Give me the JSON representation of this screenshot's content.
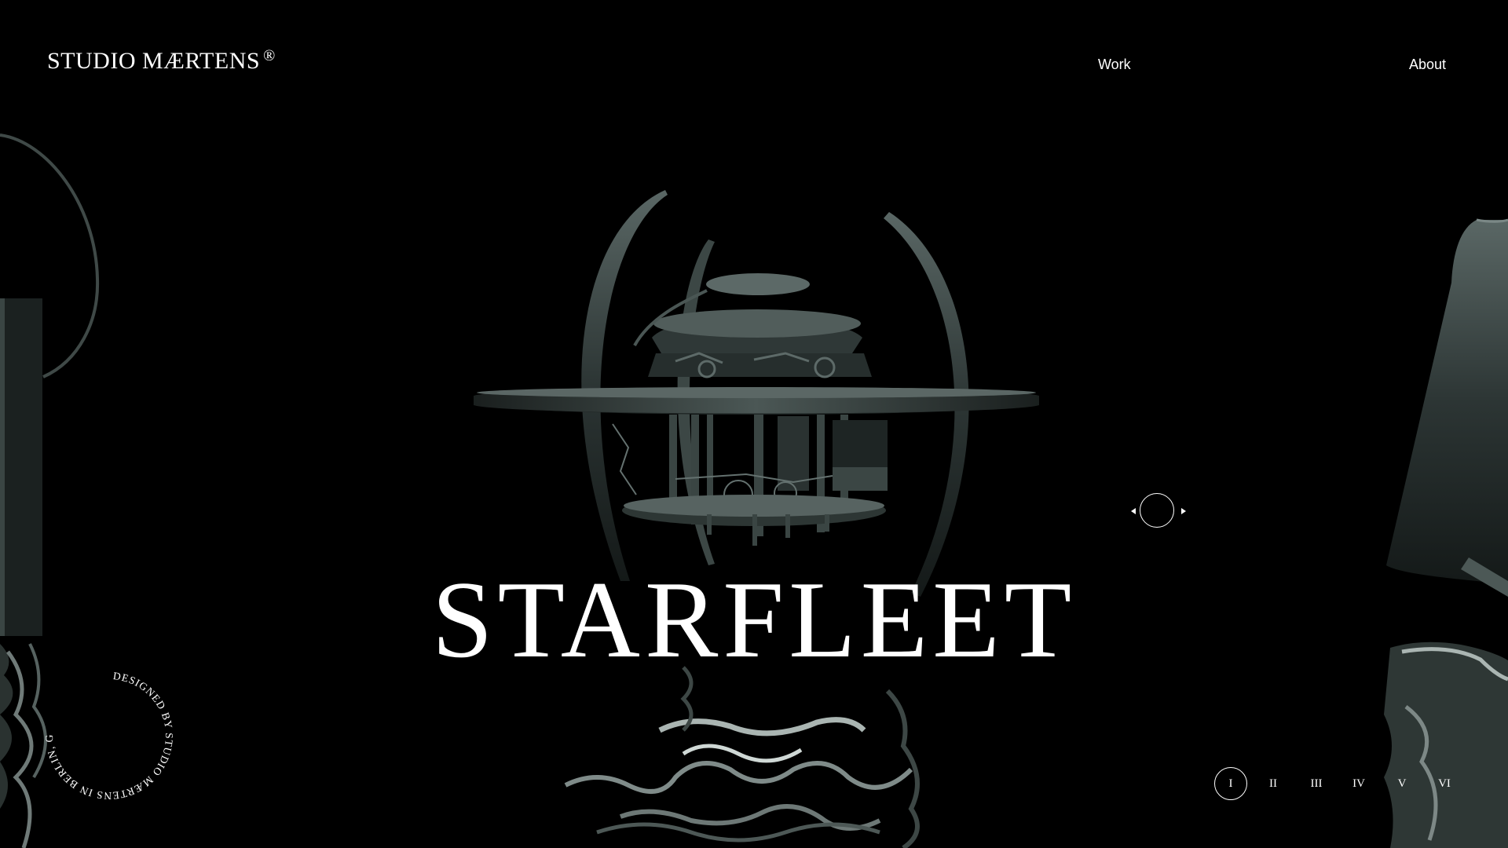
{
  "header": {
    "logo_text": "STUDIO MÆRTENS",
    "logo_mark": "®",
    "nav": [
      {
        "label": "Work"
      },
      {
        "label": "About"
      }
    ]
  },
  "hero": {
    "title": "STARFLEET",
    "object_icon": "armillary-clock-sculpture"
  },
  "badge": {
    "text": "DESIGNED BY STUDIO MÆRTENS IN BERLIN, GERMANY."
  },
  "carousel": {
    "prev_icon": "triangle-left-icon",
    "next_icon": "triangle-right-icon",
    "center_icon": "circle-icon"
  },
  "pagination": {
    "pages": [
      "I",
      "II",
      "III",
      "IV",
      "V",
      "VI"
    ],
    "active_index": 0
  },
  "colors": {
    "background": "#000000",
    "text": "#ffffff",
    "metal": "#3a4543"
  }
}
